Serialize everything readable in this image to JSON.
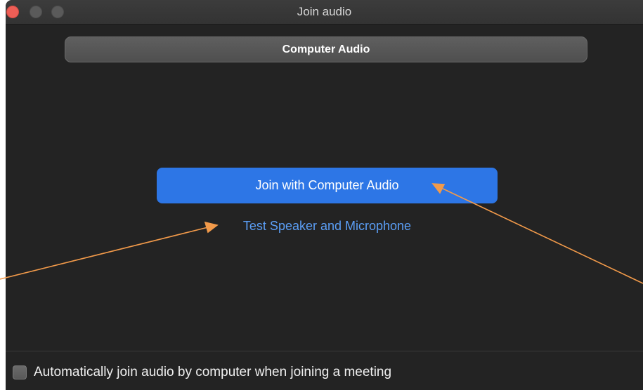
{
  "window": {
    "title": "Join audio"
  },
  "tabs": {
    "active_label": "Computer Audio"
  },
  "main": {
    "join_button_label": "Join with Computer Audio",
    "test_link_label": "Test Speaker and Microphone"
  },
  "footer": {
    "checkbox_checked": false,
    "checkbox_label": "Automatically join audio by computer when joining a meeting"
  },
  "colors": {
    "window_bg": "#232323",
    "accent_button": "#2d76e6",
    "link": "#5b9ef5",
    "close_traffic_light": "#ee5e56",
    "annotation_arrows": "#f29a4a"
  },
  "icons": {
    "traffic_lights": [
      "close-traffic-light",
      "minimize-traffic-light",
      "zoom-traffic-light"
    ],
    "annotation": "annotation-arrow"
  }
}
